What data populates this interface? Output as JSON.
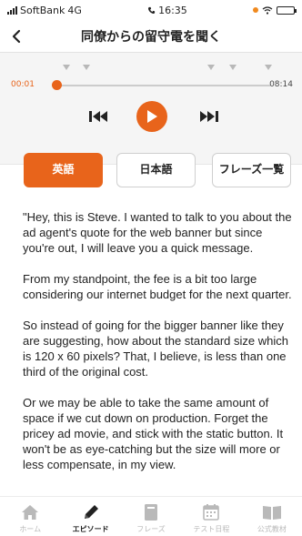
{
  "status_bar": {
    "carrier": "SoftBank",
    "network": "4G",
    "time": "16:35"
  },
  "header": {
    "title": "同僚からの留守電を聞く",
    "back_icon": "chevron-left-icon"
  },
  "player": {
    "current_time": "00:01",
    "duration": "08:14",
    "progress_fraction": 0.002,
    "accent_color": "#e8641b"
  },
  "tabs": [
    {
      "label": "英語",
      "active": true
    },
    {
      "label": "日本語",
      "active": false
    },
    {
      "label": "フレーズ一覧",
      "active": false
    }
  ],
  "transcript": [
    "\"Hey, this is Steve. I wanted to talk to you about the ad agent's quote for the web banner but since you're out, I will leave you a quick message.",
    "From my standpoint, the fee is a bit too large considering our internet budget for the next quarter.",
    "So instead of going for the bigger banner like they are suggesting, how about the standard size which is 120 x 60 pixels? That, I believe, is less than one third of the original cost.",
    "Or we may be able to take the same amount of space if we cut down on production. Forget the pricey ad movie, and stick with the static button. It won't be as eye-catching but the size will more or less compensate, in my view."
  ],
  "tab_bar": [
    {
      "label": "ホーム",
      "icon": "home-icon",
      "active": false
    },
    {
      "label": "エピソード",
      "icon": "pen-icon",
      "active": true
    },
    {
      "label": "フレーズ",
      "icon": "card-icon",
      "active": false
    },
    {
      "label": "テスト日程",
      "icon": "calendar-icon",
      "active": false
    },
    {
      "label": "公式教材",
      "icon": "book-icon",
      "active": false
    }
  ]
}
